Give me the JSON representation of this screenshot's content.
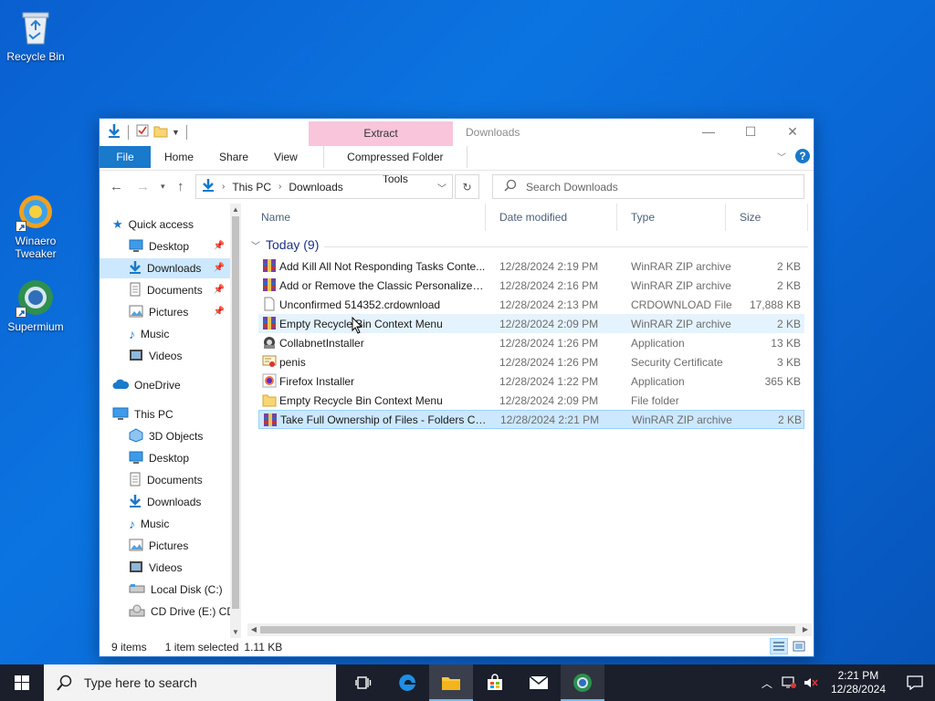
{
  "desktop": {
    "icons": [
      {
        "label": "Recycle Bin",
        "icon": "recycle-bin-icon"
      },
      {
        "label": "Winaero Tweaker",
        "icon": "winaero-tweaker-icon"
      },
      {
        "label": "Supermium",
        "icon": "supermium-icon"
      }
    ]
  },
  "window": {
    "title": "Downloads",
    "context_tab_header": "Extract",
    "ribbon": {
      "tabs": [
        "File",
        "Home",
        "Share",
        "View",
        "Compressed Folder Tools"
      ]
    },
    "address": {
      "crumbs": [
        "This PC",
        "Downloads"
      ]
    },
    "search": {
      "placeholder": "Search Downloads"
    },
    "nav": {
      "quick_access": "Quick access",
      "quick_items": [
        "Desktop",
        "Downloads",
        "Documents",
        "Pictures",
        "Music",
        "Videos"
      ],
      "onedrive": "OneDrive",
      "this_pc": "This PC",
      "pc_items": [
        "3D Objects",
        "Desktop",
        "Documents",
        "Downloads",
        "Music",
        "Pictures",
        "Videos",
        "Local Disk (C:)",
        "CD Drive (E:) CDR"
      ]
    },
    "columns": [
      "Name",
      "Date modified",
      "Type",
      "Size"
    ],
    "group": "Today (9)",
    "files": [
      {
        "name": "Add Kill All Not Responding Tasks Conte...",
        "date": "12/28/2024 2:19 PM",
        "type": "WinRAR ZIP archive",
        "size": "2 KB",
        "icon": "winrar-zip-icon"
      },
      {
        "name": "Add or Remove the Classic Personalize C...",
        "date": "12/28/2024 2:16 PM",
        "type": "WinRAR ZIP archive",
        "size": "2 KB",
        "icon": "winrar-zip-icon"
      },
      {
        "name": "Unconfirmed 514352.crdownload",
        "date": "12/28/2024 2:13 PM",
        "type": "CRDOWNLOAD File",
        "size": "17,888 KB",
        "icon": "blank-file-icon"
      },
      {
        "name": "Empty Recycle Bin Context Menu",
        "date": "12/28/2024 2:09 PM",
        "type": "WinRAR ZIP archive",
        "size": "2 KB",
        "icon": "winrar-zip-icon"
      },
      {
        "name": "CollabnetInstaller",
        "date": "12/28/2024 1:26 PM",
        "type": "Application",
        "size": "13 KB",
        "icon": "installer-app-icon"
      },
      {
        "name": "penis",
        "date": "12/28/2024 1:26 PM",
        "type": "Security Certificate",
        "size": "3 KB",
        "icon": "certificate-icon"
      },
      {
        "name": "Firefox Installer",
        "date": "12/28/2024 1:22 PM",
        "type": "Application",
        "size": "365 KB",
        "icon": "firefox-icon"
      },
      {
        "name": "Empty Recycle Bin Context Menu",
        "date": "12/28/2024 2:09 PM",
        "type": "File folder",
        "size": "",
        "icon": "folder-icon"
      },
      {
        "name": "Take Full Ownership of Files - Folders Co...",
        "date": "12/28/2024 2:21 PM",
        "type": "WinRAR ZIP archive",
        "size": "2 KB",
        "icon": "winrar-zip-icon"
      }
    ],
    "status": {
      "count": "9 items",
      "selected": "1 item selected",
      "size": "1.11 KB"
    }
  },
  "taskbar": {
    "search_placeholder": "Type here to search",
    "time": "2:21 PM",
    "date": "12/28/2024"
  },
  "colors": {
    "accent": "#1979ca",
    "selection": "#cce8ff",
    "context_tab": "#f8c5db",
    "desktop": "#0b74e0"
  }
}
